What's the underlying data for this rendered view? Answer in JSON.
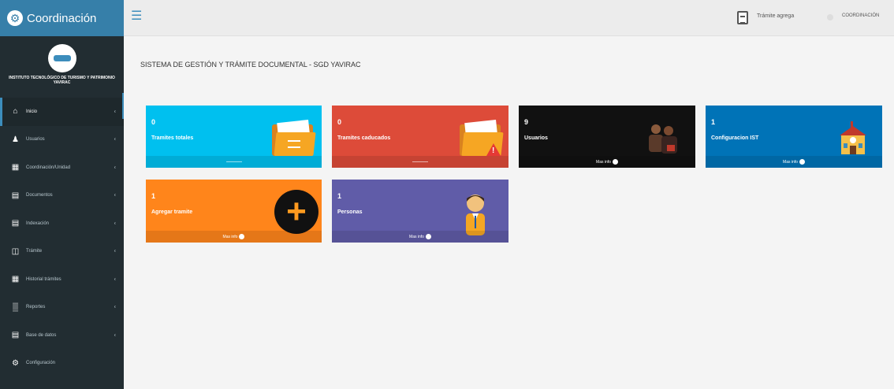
{
  "brand": {
    "title": "Coordinación"
  },
  "sidebar": {
    "institution": "INSTITUTO TECNOLÓGICO DE TURISMO Y PATRIMONIO YAVIRAC",
    "items": [
      {
        "label": "Inicio",
        "icon": "home-icon"
      },
      {
        "label": "Usuarios",
        "icon": "users-icon"
      },
      {
        "label": "Coordinación/Unidad",
        "icon": "building-icon"
      },
      {
        "label": "Documentos",
        "icon": "folder-icon"
      },
      {
        "label": "Indexación",
        "icon": "list-icon"
      },
      {
        "label": "Trámite",
        "icon": "file-icon"
      },
      {
        "label": "Historial trámites",
        "icon": "history-icon"
      },
      {
        "label": "Reportes",
        "icon": "chart-icon"
      },
      {
        "label": "Base de datos",
        "icon": "database-icon"
      },
      {
        "label": "Configuración",
        "icon": "gear-icon"
      }
    ]
  },
  "header": {
    "tramite": "Trámite agrega",
    "user": "COORDINACIÓN"
  },
  "page_title": "SISTEMA DE GESTIÓN Y TRÁMITE DOCUMENTAL - SGD YAVIRAC",
  "boxes": [
    {
      "number": "0",
      "label": "Tramites totales",
      "footer": "",
      "color": "#00c0ef"
    },
    {
      "number": "0",
      "label": "Tramites caducados",
      "footer": "",
      "color": "#dd4b39"
    },
    {
      "number": "9",
      "label": "Usuarios",
      "footer": "Mas info",
      "color": "#111111"
    },
    {
      "number": "1",
      "label": "Configuracion IST",
      "footer": "Mas info",
      "color": "#0073b7"
    },
    {
      "number": "1",
      "label": "Agregar tramite",
      "footer": "Mas info",
      "color": "#ff851b"
    },
    {
      "number": "1",
      "label": "Personas",
      "footer": "Mas info",
      "color": "#605ca8"
    }
  ]
}
